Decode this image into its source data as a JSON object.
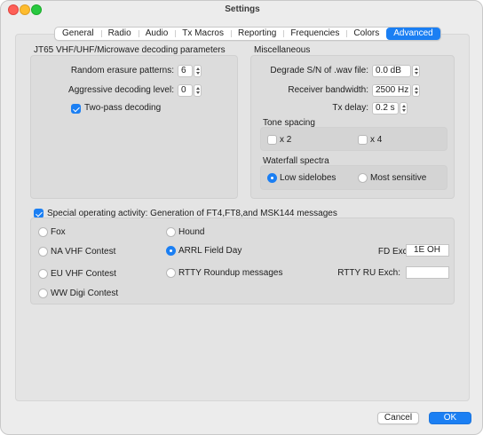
{
  "window": {
    "title": "Settings"
  },
  "tabs": [
    "General",
    "Radio",
    "Audio",
    "Tx Macros",
    "Reporting",
    "Frequencies",
    "Colors",
    "Advanced"
  ],
  "active_tab": "Advanced",
  "jt65": {
    "title": "JT65 VHF/UHF/Microwave decoding parameters",
    "random_erasure_label": "Random erasure patterns:",
    "random_erasure_value": "6",
    "aggressive_label": "Aggressive decoding level:",
    "aggressive_value": "0",
    "two_pass_label": "Two-pass decoding",
    "two_pass_checked": true
  },
  "misc": {
    "title": "Miscellaneous",
    "degrade_label": "Degrade S/N of .wav file:",
    "degrade_value": "0.0 dB",
    "bandwidth_label": "Receiver bandwidth:",
    "bandwidth_value": "2500  Hz",
    "txdelay_label": "Tx delay:",
    "txdelay_value": "0.2 s",
    "tone_spacing": {
      "title": "Tone spacing",
      "x2_label": "x 2",
      "x4_label": "x 4"
    },
    "waterfall": {
      "title": "Waterfall spectra",
      "low_label": "Low sidelobes",
      "most_label": "Most sensitive",
      "selected": "Low sidelobes"
    }
  },
  "special": {
    "checkbox_label": "Special operating activity:  Generation of FT4,FT8,and MSK144 messages",
    "checked": true,
    "options": {
      "fox": "Fox",
      "hound": "Hound",
      "na_vhf": "NA VHF Contest",
      "arrl_fd": "ARRL Field Day",
      "eu_vhf": "EU VHF Contest",
      "rtty_roundup": "RTTY Roundup messages",
      "ww_digi": "WW Digi Contest"
    },
    "selected": "ARRL Field Day",
    "fd_exch_label": "FD Exch:",
    "fd_exch_value": "1E OH",
    "rtty_exch_label": "RTTY RU Exch:",
    "rtty_exch_value": ""
  },
  "buttons": {
    "cancel": "Cancel",
    "ok": "OK"
  },
  "colors": {
    "accent": "#1b7ff3",
    "window_bg": "#ececec"
  }
}
